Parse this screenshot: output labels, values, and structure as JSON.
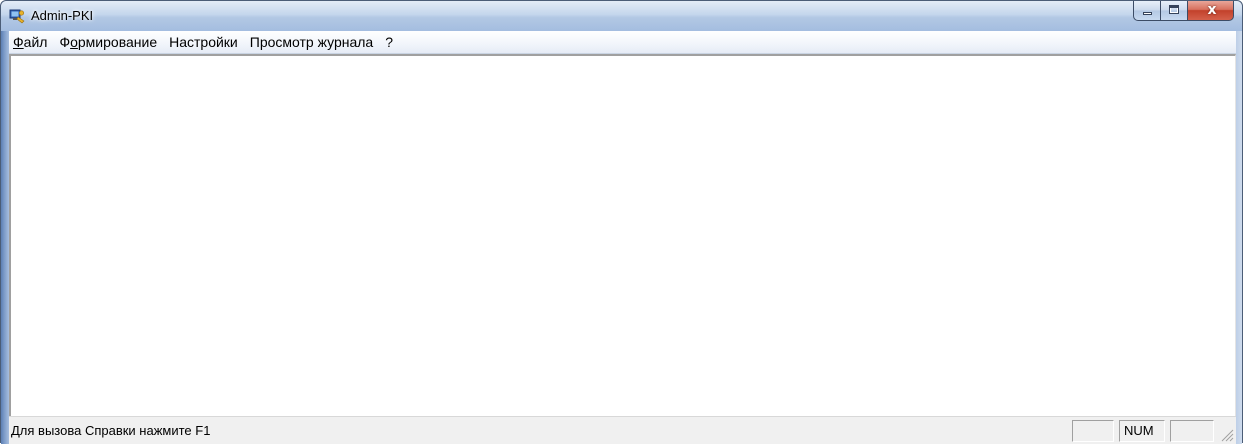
{
  "window": {
    "title": "Admin-PKI",
    "icon": "admin-pki-app-icon"
  },
  "caption_buttons": {
    "minimize_icon": "minimize-icon",
    "maximize_icon": "maximize-icon",
    "close_icon": "close-icon",
    "close_glyph": "x"
  },
  "menu": {
    "items": [
      {
        "underline": "Ф",
        "rest": "айл"
      },
      {
        "before": "Ф",
        "underline": "о",
        "rest": "рмирование"
      },
      {
        "label": "Настройки"
      },
      {
        "label": "Просмотр журнала"
      },
      {
        "label": "?"
      }
    ]
  },
  "statusbar": {
    "text": "Для вызова Справки нажмите F1",
    "panes": [
      "",
      "NUM",
      ""
    ]
  },
  "colors": {
    "titlebar": "#b2c8e4",
    "close_button": "#c2412b",
    "client_bg": "#ffffff",
    "statusbar_bg": "#f0f0f0"
  }
}
